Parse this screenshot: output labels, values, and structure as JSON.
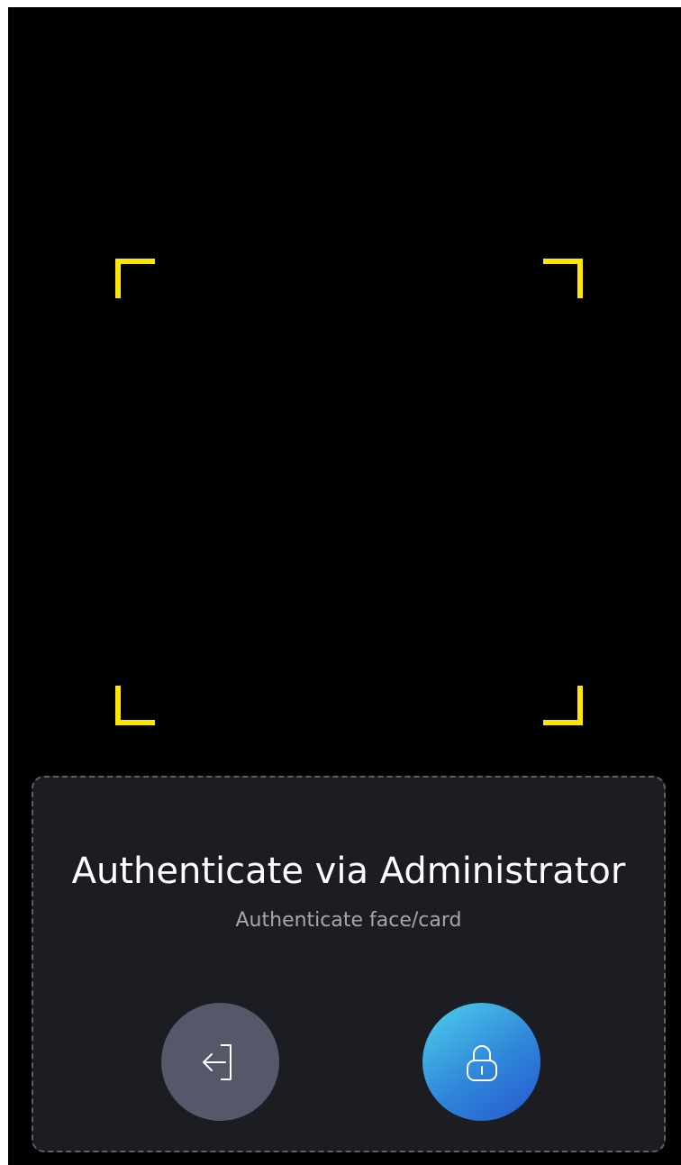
{
  "auth_panel": {
    "title": "Authenticate via Administrator",
    "subtitle": "Authenticate face/card"
  },
  "buttons": {
    "exit_icon": "exit-icon",
    "unlock_icon": "unlock-icon"
  },
  "colors": {
    "frame_accent": "#FFE600",
    "panel_background": "#1C1D22",
    "exit_button": "#555869",
    "unlock_button_gradient": [
      "#4FD0EC",
      "#2557CF"
    ]
  }
}
